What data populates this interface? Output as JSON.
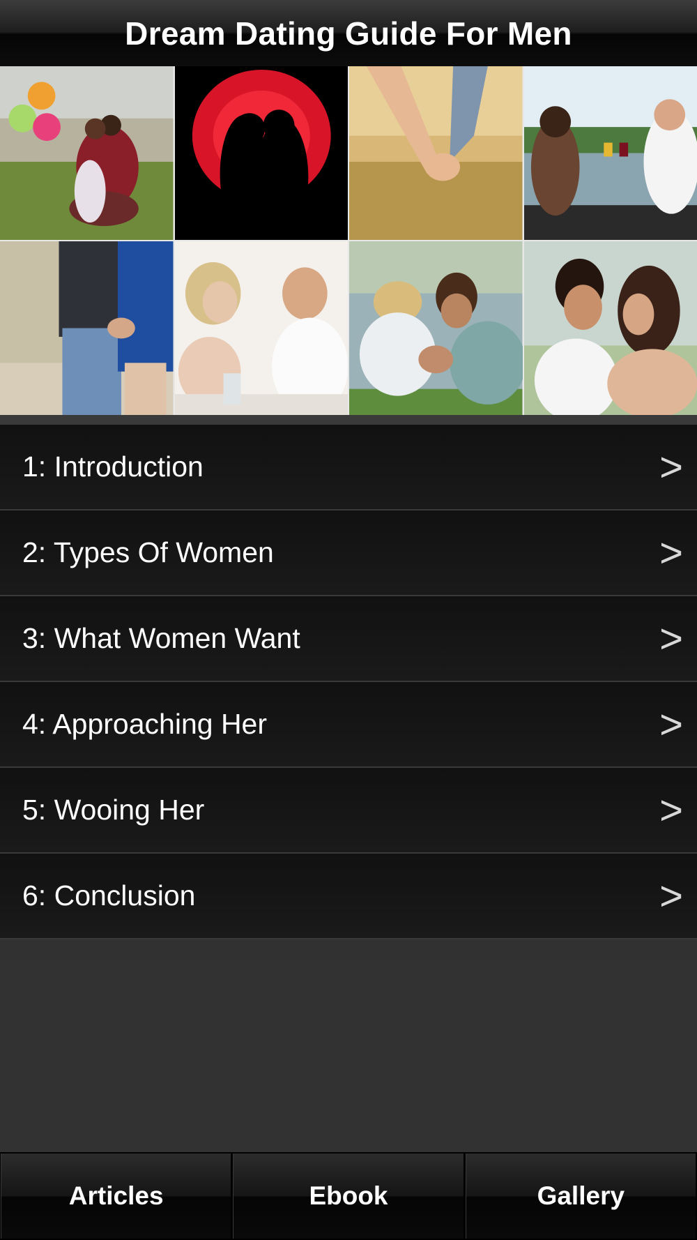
{
  "header": {
    "title": "Dream Dating Guide For Men"
  },
  "gallery": {
    "photos": [
      {
        "name": "couple-with-balloons"
      },
      {
        "name": "silhouette-kiss-red-heart"
      },
      {
        "name": "holding-hands-field"
      },
      {
        "name": "couple-toasting-wine"
      },
      {
        "name": "couple-holding-hands-behind"
      },
      {
        "name": "couple-talking-at-table"
      },
      {
        "name": "couple-lying-on-grass"
      },
      {
        "name": "couple-forehead-touch"
      }
    ]
  },
  "menu": {
    "items": [
      {
        "label": "1: Introduction",
        "chevron": ">"
      },
      {
        "label": "2: Types Of Women",
        "chevron": ">"
      },
      {
        "label": "3: What Women Want",
        "chevron": ">"
      },
      {
        "label": "4: Approaching Her",
        "chevron": ">"
      },
      {
        "label": "5: Wooing Her",
        "chevron": ">"
      },
      {
        "label": "6: Conclusion",
        "chevron": ">"
      }
    ]
  },
  "tabbar": {
    "tabs": [
      {
        "label": "Articles"
      },
      {
        "label": "Ebook"
      },
      {
        "label": "Gallery"
      }
    ]
  }
}
